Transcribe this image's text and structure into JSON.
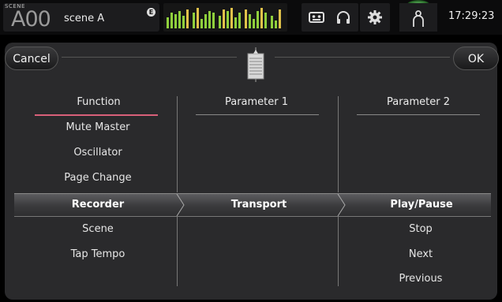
{
  "topbar": {
    "scene_label": "SCENE",
    "scene_number": "A00",
    "scene_name": "scene A",
    "scene_badge": "E",
    "clock": "17:29:23",
    "icons": [
      "meter-bridge-icon",
      "recorder-tape-icon",
      "headphones-icon",
      "gear-icon",
      "user-icon"
    ]
  },
  "dialog": {
    "cancel_label": "Cancel",
    "ok_label": "OK",
    "columns": {
      "function": "Function",
      "param1": "Parameter 1",
      "param2": "Parameter 2"
    },
    "function_items": [
      "Mute Master",
      "Oscillator",
      "Page Change",
      "Recorder",
      "Scene",
      "Tap Tempo"
    ],
    "param2_items": [
      "Stop",
      "Next",
      "Previous"
    ],
    "selected": {
      "function": "Recorder",
      "param1": "Transport",
      "param2": "Play/Pause"
    },
    "accent_color": "#d9607a"
  }
}
